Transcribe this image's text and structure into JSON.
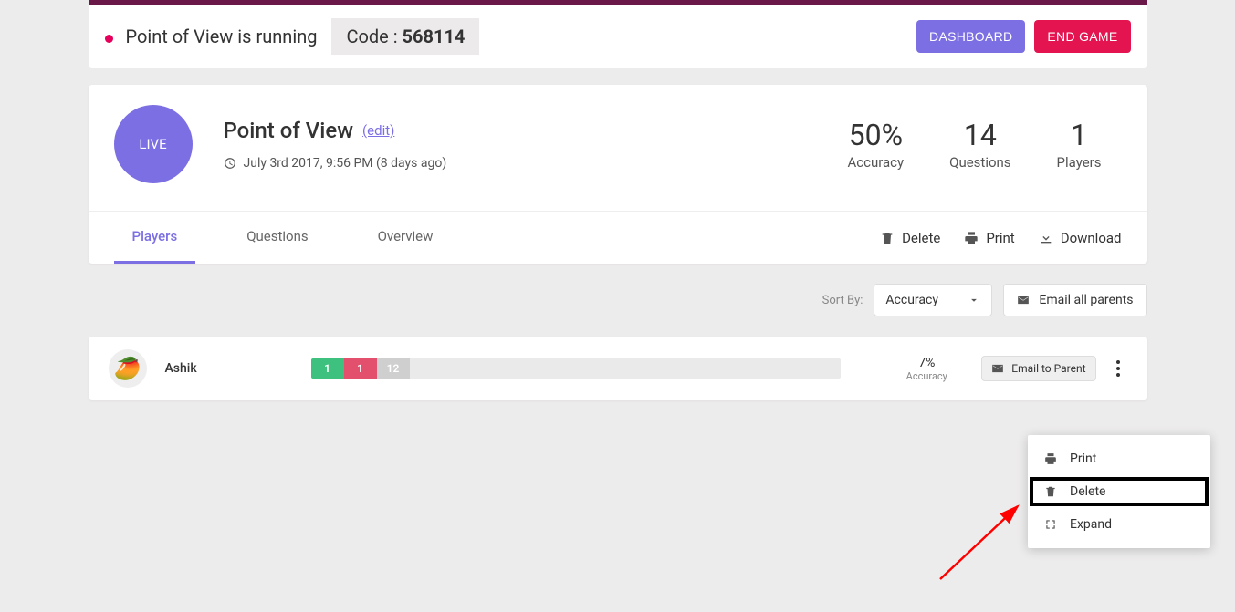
{
  "topbar": {
    "running_text": "Point of View is running",
    "code_label": "Code : ",
    "code_value": "568114",
    "dashboard_btn": "DASHBOARD",
    "end_game_btn": "END GAME"
  },
  "main": {
    "live_badge": "LIVE",
    "title": "Point of View",
    "edit_label": "(edit)",
    "timestamp": "July 3rd 2017, 9:56 PM (8 days ago)",
    "stats": {
      "accuracy_val": "50%",
      "accuracy_lbl": "Accuracy",
      "questions_val": "14",
      "questions_lbl": "Questions",
      "players_val": "1",
      "players_lbl": "Players"
    }
  },
  "tabs": {
    "players": "Players",
    "questions": "Questions",
    "overview": "Overview"
  },
  "actions": {
    "delete": "Delete",
    "print": "Print",
    "download": "Download"
  },
  "filter": {
    "sort_by_lbl": "Sort By:",
    "sort_selected": "Accuracy",
    "email_all": "Email all parents"
  },
  "player": {
    "name": "Ashik",
    "seg_correct": "1",
    "seg_wrong": "1",
    "seg_unattempted": "12",
    "accuracy_val": "7%",
    "accuracy_lbl": "Accuracy",
    "email_btn": "Email to Parent"
  },
  "dropdown": {
    "print": "Print",
    "delete": "Delete",
    "expand": "Expand"
  }
}
